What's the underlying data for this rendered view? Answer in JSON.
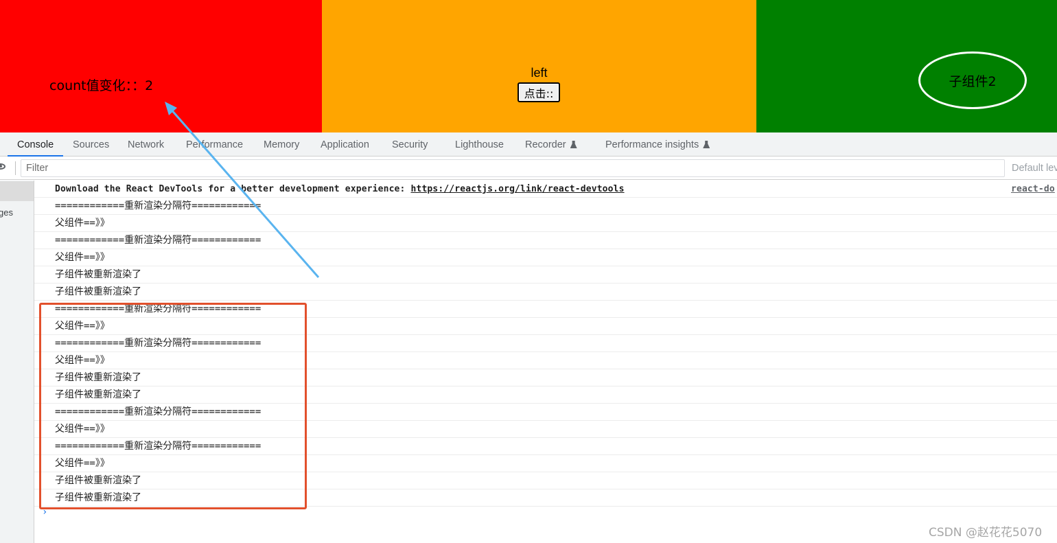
{
  "app": {
    "count_text": "count值变化：：2",
    "left_label": "left",
    "click_button": "点击::",
    "child_label": "子组件2",
    "colors": {
      "red": "#ff0000",
      "orange": "#ffa500",
      "green": "#008000"
    }
  },
  "devtools": {
    "tabs": [
      {
        "label": "Console",
        "active": true
      },
      {
        "label": "Sources"
      },
      {
        "label": "Network"
      },
      {
        "label": "Performance"
      },
      {
        "label": "Memory"
      },
      {
        "label": "Application"
      },
      {
        "label": "Security"
      },
      {
        "label": "Lighthouse"
      },
      {
        "label": "Recorder",
        "experimental": true
      },
      {
        "label": "Performance insights",
        "experimental": true
      }
    ],
    "filter_placeholder": "Filter",
    "levels_label": "Default lev",
    "sidebar_label": "ges",
    "console": {
      "first_message": "Download the React DevTools for a better development experience: ",
      "first_link": "https://reactjs.org/link/react-devtools",
      "first_source": "react-do",
      "separator": "============重新渲染分隔符============",
      "parent": "父组件==》》",
      "child": "子组件被重新渲染了",
      "prompt": "›"
    }
  },
  "watermark": "CSDN @赵花花5070"
}
